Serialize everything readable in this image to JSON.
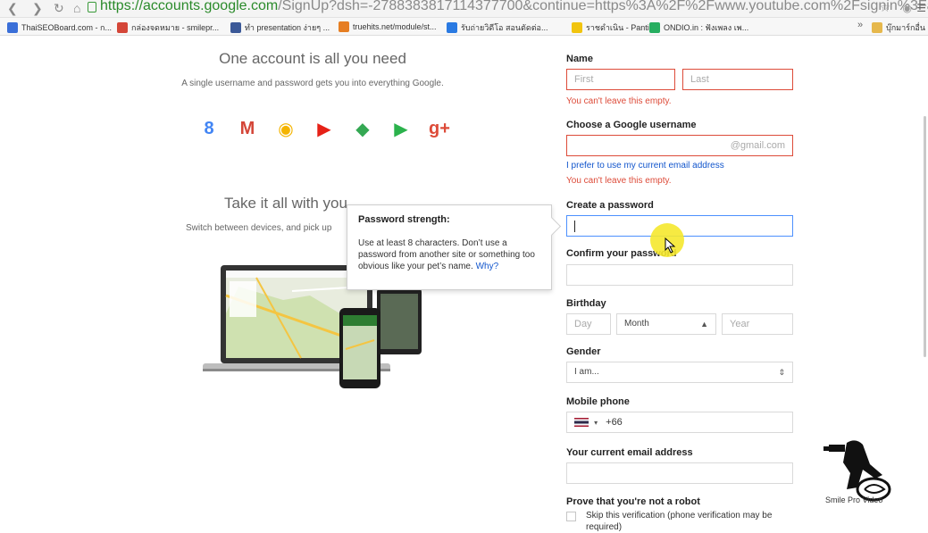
{
  "browser": {
    "url_secure": "https://accounts.google.com",
    "url_rest": "/SignUp?dsh=-2788383817114377700&continue=https%3A%2F%2Fwww.youtube.com%2Fsignin%3Faction_handle_"
  },
  "bookmarks": [
    {
      "icon": "thaiseoboard-icon",
      "label": "ThaiSEOBoard.com - ก...",
      "color": "#3a6fd8"
    },
    {
      "icon": "gmail-icon",
      "label": "กล่องจดหมาย - smilepr...",
      "color": "#d44638"
    },
    {
      "icon": "facebook-icon",
      "label": "ทำ presentation ง่ายๆ ...",
      "color": "#3b5998"
    },
    {
      "icon": "truehits-icon",
      "label": "truehits.net/module/st...",
      "color": "#e67e22"
    },
    {
      "icon": "video-icon",
      "label": "รับถ่ายวิดีโอ สอนตัดต่อ...",
      "color": "#2a7ae2"
    },
    {
      "icon": "pantip-icon",
      "label": "ราชดำเนิน - Pantip",
      "color": "#f1c40f"
    },
    {
      "icon": "ondio-icon",
      "label": "ONDIO.in : ฟังเพลง เพ...",
      "color": "#27ae60"
    },
    {
      "icon": "folder-icon",
      "label": "บุ๊กมาร์กอื่น",
      "color": "#e6b84c"
    }
  ],
  "bookmarks_more": "»",
  "left": {
    "heading": "One account is all you need",
    "subheading": "A single username and password gets you into everything Google.",
    "heading2": "Take it all with you",
    "subheading2": "Switch between devices, and pick up"
  },
  "apps": [
    {
      "name": "google-search-icon",
      "color": "#4285f4",
      "glyph": "8"
    },
    {
      "name": "gmail-app-icon",
      "color": "#d44638",
      "glyph": "M"
    },
    {
      "name": "chrome-app-icon",
      "color": "#f4b400",
      "glyph": "◉"
    },
    {
      "name": "youtube-app-icon",
      "color": "#e62117",
      "glyph": "▶"
    },
    {
      "name": "maps-app-icon",
      "color": "#34a853",
      "glyph": "◆"
    },
    {
      "name": "play-app-icon",
      "color": "#2bb24c",
      "glyph": "▶"
    },
    {
      "name": "googleplus-app-icon",
      "color": "#dd4b39",
      "glyph": "g+"
    }
  ],
  "tooltip": {
    "title": "Password strength:",
    "body": "Use at least 8 characters. Don’t use a password from another site or something too obvious like your pet’s name.",
    "link": "Why?"
  },
  "form": {
    "name_label": "Name",
    "first_placeholder": "First",
    "last_placeholder": "Last",
    "name_error": "You can't leave this empty.",
    "username_label": "Choose a Google username",
    "username_suffix": "@gmail.com",
    "use_current_email": "I prefer to use my current email address",
    "username_error": "You can't leave this empty.",
    "password_label": "Create a password",
    "confirm_label": "Confirm your password",
    "birthday_label": "Birthday",
    "day_placeholder": "Day",
    "month_value": "Month",
    "year_placeholder": "Year",
    "gender_label": "Gender",
    "gender_value": "I am...",
    "mobile_label": "Mobile phone",
    "country_code": "+66",
    "current_email_label": "Your current email address",
    "robot_label": "Prove that you're not a robot",
    "skip_verification": "Skip this verification (phone verification may be required)"
  },
  "watermark": {
    "text": "Smile Pro Video"
  }
}
